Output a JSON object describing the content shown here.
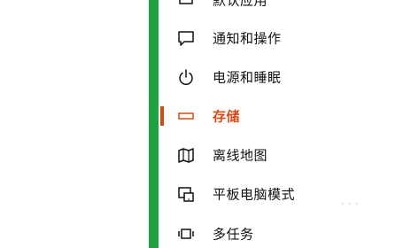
{
  "colors": {
    "accent": "#d84a14",
    "green_bar": "#21a242",
    "text": "#111111"
  },
  "nav": {
    "items": [
      {
        "label": "默认应用",
        "icon": "default-apps-icon",
        "active": false
      },
      {
        "label": "通知和操作",
        "icon": "notification-icon",
        "active": false
      },
      {
        "label": "电源和睡眠",
        "icon": "power-icon",
        "active": false
      },
      {
        "label": "存储",
        "icon": "storage-icon",
        "active": true
      },
      {
        "label": "离线地图",
        "icon": "map-icon",
        "active": false
      },
      {
        "label": "平板电脑模式",
        "icon": "tablet-mode-icon",
        "active": false
      },
      {
        "label": "多任务",
        "icon": "multitasking-icon",
        "active": false
      }
    ]
  }
}
